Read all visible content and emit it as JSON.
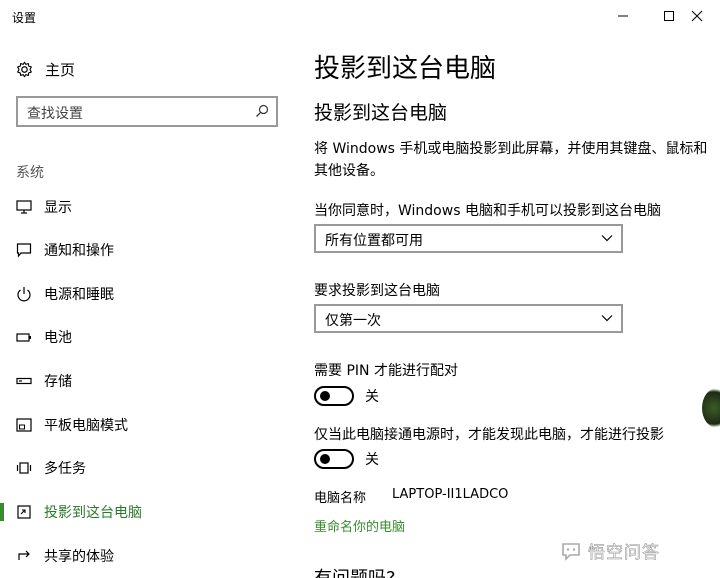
{
  "window": {
    "title": "设置"
  },
  "sidebar": {
    "home_label": "主页",
    "search_placeholder": "查找设置",
    "group_title": "系统",
    "items": [
      {
        "label": "显示",
        "icon": "monitor-icon"
      },
      {
        "label": "通知和操作",
        "icon": "message-icon"
      },
      {
        "label": "电源和睡眠",
        "icon": "power-icon"
      },
      {
        "label": "电池",
        "icon": "battery-icon"
      },
      {
        "label": "存储",
        "icon": "storage-icon"
      },
      {
        "label": "平板电脑模式",
        "icon": "tablet-icon"
      },
      {
        "label": "多任务",
        "icon": "multitask-icon"
      },
      {
        "label": "投影到这台电脑",
        "icon": "project-icon",
        "active": true
      },
      {
        "label": "共享的体验",
        "icon": "share-icon"
      }
    ]
  },
  "main": {
    "page_title": "投影到这台电脑",
    "section_title": "投影到这台电脑",
    "description": "将 Windows 手机或电脑投影到此屏幕，并使用其键盘、鼠标和其他设备。",
    "consent_label": "当你同意时，Windows 电脑和手机可以投影到这台电脑",
    "consent_value": "所有位置都可用",
    "require_label": "要求投影到这台电脑",
    "require_value": "仅第一次",
    "pin_label": "需要 PIN 才能进行配对",
    "pin_state": "关",
    "power_label": "仅当此电脑接通电源时，才能发现此电脑，才能进行投影",
    "power_state": "关",
    "pc_name_label": "电脑名称",
    "pc_name_value": "LAPTOP-II1LADCO",
    "rename_link": "重命名你的电脑",
    "questions_title": "有问题吗?"
  },
  "watermark": {
    "text": "悟空问答"
  },
  "colors": {
    "accent": "#3a8a30",
    "border": "#999999"
  }
}
